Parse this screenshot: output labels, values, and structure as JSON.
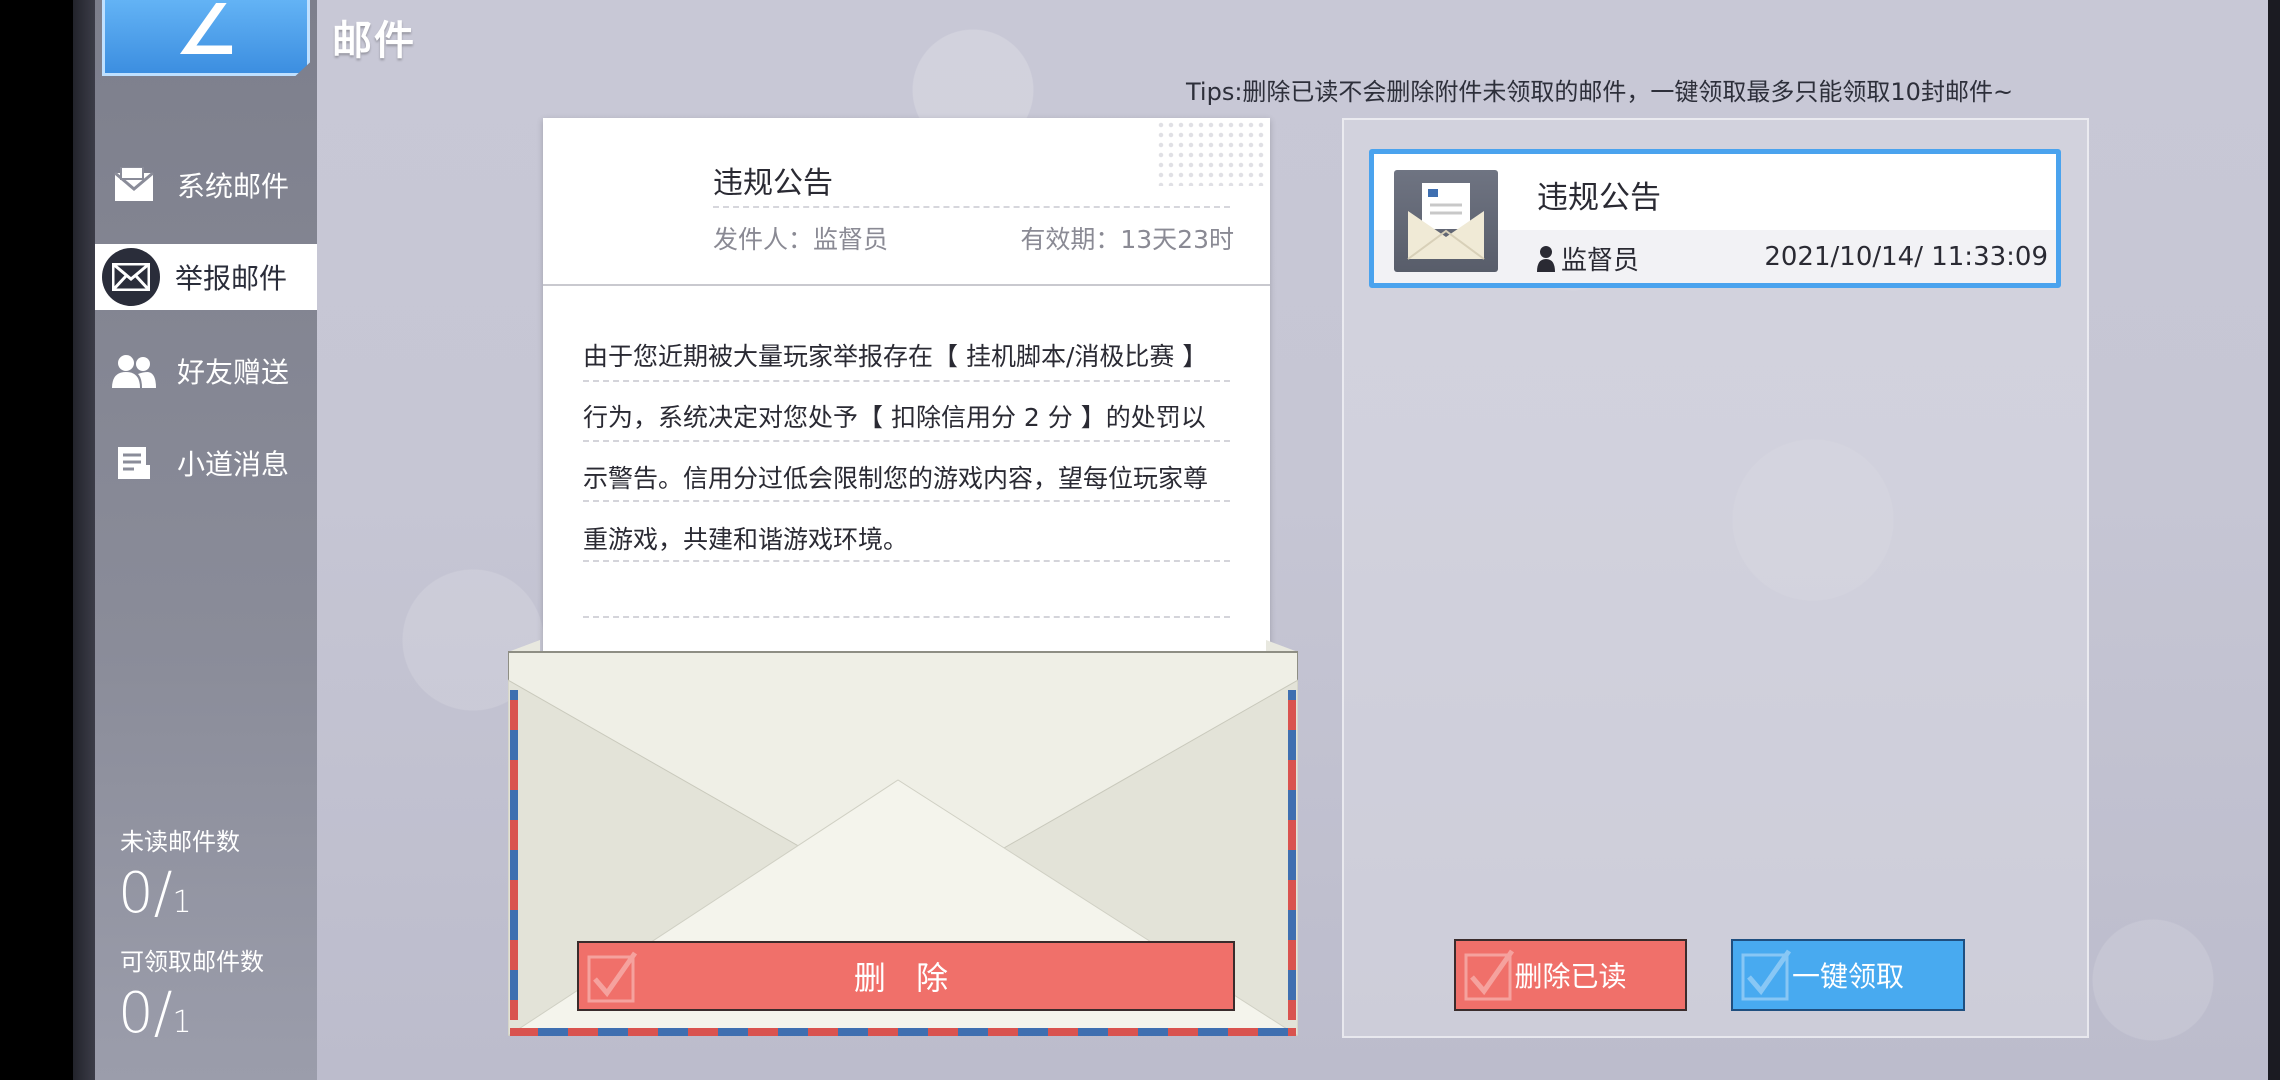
{
  "header": {
    "logo_glyph": "∠",
    "title": "邮件"
  },
  "sidebar": {
    "items": [
      {
        "label": "系统邮件",
        "icon": "system-mail-icon",
        "active": false
      },
      {
        "label": "举报邮件",
        "icon": "report-mail-icon",
        "active": true
      },
      {
        "label": "好友赠送",
        "icon": "friends-icon",
        "active": false
      },
      {
        "label": "小道消息",
        "icon": "news-icon",
        "active": false
      }
    ],
    "unread": {
      "label": "未读邮件数",
      "value": "0",
      "total": "1"
    },
    "claimable": {
      "label": "可领取邮件数",
      "value": "0",
      "total": "1"
    }
  },
  "tips": "Tips:删除已读不会删除附件未领取的邮件，一键领取最多只能领取10封邮件~",
  "letter": {
    "title": "违规公告",
    "sender": "发件人：监督员",
    "expiry": "有效期：13天23时",
    "body": "由于您近期被大量玩家举报存在【 挂机脚本/消极比赛 】行为，系统决定对您处予【 扣除信用分 2 分 】的处罚以示警告。信用分过低会限制您的游戏内容，望每位玩家尊重游戏，共建和谐游戏环境。"
  },
  "mail_list": [
    {
      "title": "违规公告",
      "sender": "监督员",
      "date": "2021/10/14/ 11:33:09",
      "selected": true
    }
  ],
  "buttons": {
    "delete": "删 除",
    "delete_read": "删除已读",
    "claim_all": "一键领取"
  },
  "colors": {
    "accent_blue": "#48aaf0",
    "danger_red": "#f0706a",
    "sidebar_bg": "#8a8c99"
  }
}
